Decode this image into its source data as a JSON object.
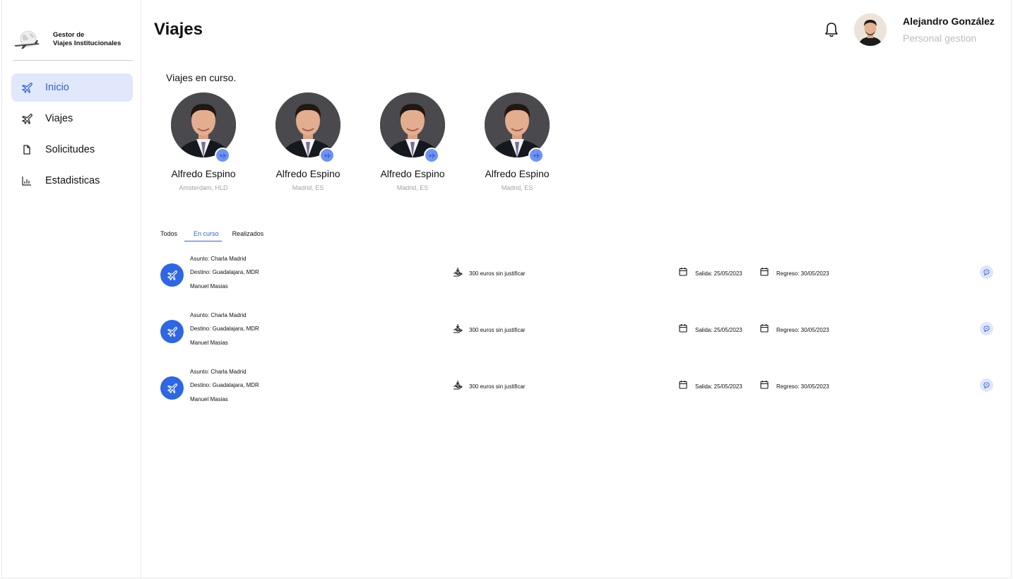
{
  "brand": {
    "line1": "Gestor de",
    "line2": "Viajes Institucionales"
  },
  "sidebar": {
    "items": [
      {
        "label": "Inicio",
        "icon": "plane-icon",
        "active": true
      },
      {
        "label": "Viajes",
        "icon": "plane-icon",
        "active": false
      },
      {
        "label": "Solicitudes",
        "icon": "document-icon",
        "active": false
      },
      {
        "label": "Estadisticas",
        "icon": "bar-chart-icon",
        "active": false
      }
    ]
  },
  "header": {
    "title": "Viajes"
  },
  "user": {
    "name": "Alejandro González",
    "role": "Personal gestion"
  },
  "ongoing": {
    "title": "Viajes en curso.",
    "travelers": [
      {
        "name": "Alfredo Espino",
        "city": "Amsterdam, HLD"
      },
      {
        "name": "Alfredo Espino",
        "city": "Madrid, ES"
      },
      {
        "name": "Alfredo Espino",
        "city": "Madrid, ES"
      },
      {
        "name": "Alfredo Espino",
        "city": "Madrid, ES"
      }
    ]
  },
  "tabs": [
    {
      "label": "Todos",
      "active": false
    },
    {
      "label": "En curso",
      "active": true
    },
    {
      "label": "Realizados",
      "active": false
    }
  ],
  "trips": [
    {
      "asunto": "Asunto: Charla Madrid",
      "destino": "Destino: Guadalajara, MDR",
      "person": "Manuel Masias",
      "budget": "300 euros sin justificar",
      "salida": "Salida: 25/05/2023",
      "regreso": "Regreso: 30/05/2023"
    },
    {
      "asunto": "Asunto: Charla Madrid",
      "destino": "Destino: Guadalajara, MDR",
      "person": "Manuel Masias",
      "budget": "300 euros sin justificar",
      "salida": "Salida: 25/05/2023",
      "regreso": "Regreso: 30/05/2023"
    },
    {
      "asunto": "Asunto: Charla Madrid",
      "destino": "Destino: Guadalajara, MDR",
      "person": "Manuel Masias",
      "budget": "300 euros sin justificar",
      "salida": "Salida: 25/05/2023",
      "regreso": "Regreso: 30/05/2023"
    }
  ],
  "colors": {
    "accent": "#2f66e1",
    "active_bg": "#e1e8fb",
    "badge": "#6f93ee",
    "muted": "#bdbdbd"
  }
}
